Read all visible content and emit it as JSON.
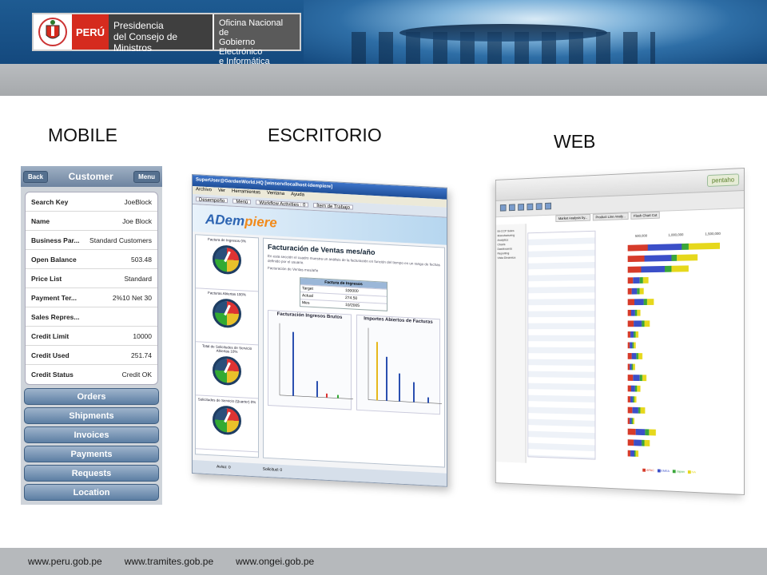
{
  "header": {
    "country": "PERÚ",
    "presidencia_line1": "Presidencia",
    "presidencia_line2": "del Consejo de Ministros",
    "ongei_line1": "Oficina Nacional de",
    "ongei_line2": "Gobierno Electrónico",
    "ongei_line3": "e Informática"
  },
  "labels": {
    "mobile": "MOBILE",
    "desktop": "ESCRITORIO",
    "web": "WEB"
  },
  "mobile": {
    "back_label": "Back",
    "title": "Customer",
    "menu_label": "Menu",
    "rows": [
      {
        "key": "Search Key",
        "value": "JoeBlock"
      },
      {
        "key": "Name",
        "value": "Joe Block"
      },
      {
        "key": "Business Par...",
        "value": "Standard Customers"
      },
      {
        "key": "Open Balance",
        "value": "503.48"
      },
      {
        "key": "Price List",
        "value": "Standard"
      },
      {
        "key": "Payment Ter...",
        "value": "2%10 Net 30"
      },
      {
        "key": "Sales Repres...",
        "value": ""
      },
      {
        "key": "Credit Limit",
        "value": "10000"
      },
      {
        "key": "Credit Used",
        "value": "251.74"
      },
      {
        "key": "Credit Status",
        "value": "Credit OK"
      }
    ],
    "buttons": [
      "Orders",
      "Shipments",
      "Invoices",
      "Payments",
      "Requests",
      "Location"
    ]
  },
  "desktop": {
    "window_title": "SuperUser@GardenWorld.HQ [winserv/localhost-idempiere]",
    "menu": [
      "Archivo",
      "Ver",
      "Herramientas",
      "Ventana",
      "Ayuda"
    ],
    "tabs": [
      "Desempeño",
      "Menú",
      "Workflow Activities : 0",
      "Ítem de Trabajo"
    ],
    "brand_main": "ADem",
    "brand_accent": "piere",
    "gauges": [
      "Factura de Ingresos 0%",
      "Facturas Abiertas 100%",
      "Total de Solicitudes de Servicio Abiertas 10%",
      "Solicitudes de Servicio (Quarter) 0%"
    ],
    "heading": "Facturación de Ventas mes/año",
    "paragraph": "En esta sección el cuadro muestra un análisis de la facturación en función del tiempo en un rango de fechas definido por el usuario.",
    "subheading": "Facturación de Ventas mes/año",
    "fact_table": {
      "header": "Factura de Ingresos",
      "rows": [
        {
          "label": "Target",
          "value": "100000"
        },
        {
          "label": "Actual",
          "value": "274.50"
        },
        {
          "label": "Mes",
          "value": "10/2005"
        }
      ]
    },
    "chart1_title": "Facturación Ingresos Brutos",
    "chart2_title": "Importes Abiertos de Facturas",
    "status_left": "Aviso: 0",
    "status_right": "Solicitud: 0"
  },
  "web": {
    "brand": "pentaho",
    "tabs": [
      "Market Analysis by...",
      "Product Line Analy...",
      "Flash Chart Cut"
    ],
    "tree": [
      "BI-CCP Sales",
      "Manufacturing",
      "Analytics",
      "Charts",
      "Dashboards",
      "Reporting",
      "Vista Dinámica"
    ],
    "axis_ticks": [
      "500,000",
      "1,000,000",
      "1,500,000"
    ],
    "legend": [
      "APAC",
      "EMEA",
      "Japan",
      "NA"
    ],
    "colors": {
      "apac": "#d63b2a",
      "emea": "#3b4fc8",
      "japan": "#3aa63a",
      "na": "#e6d81c"
    }
  },
  "footer": {
    "links": [
      "www.peru.gob.pe",
      "www.tramites.gob.pe",
      "www.ongei.gob.pe"
    ]
  }
}
